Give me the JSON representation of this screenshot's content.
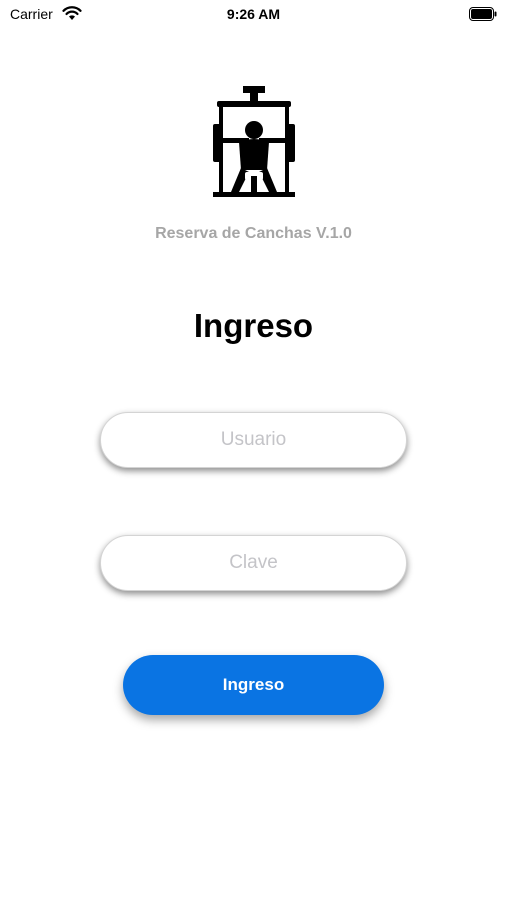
{
  "status_bar": {
    "carrier": "Carrier",
    "time": "9:26 AM",
    "icons": [
      "wifi-icon",
      "battery-icon"
    ]
  },
  "logo": {
    "icon": "gym-machine-icon"
  },
  "app_version": "Reserva de Canchas V.1.0",
  "page_title": "Ingreso",
  "form": {
    "user": {
      "placeholder": "Usuario",
      "value": ""
    },
    "password": {
      "placeholder": "Clave",
      "value": ""
    },
    "submit_label": "Ingreso"
  },
  "colors": {
    "accent": "#0a74e3",
    "subtitle": "#a6a6a6",
    "placeholder": "#c4c4c8"
  }
}
